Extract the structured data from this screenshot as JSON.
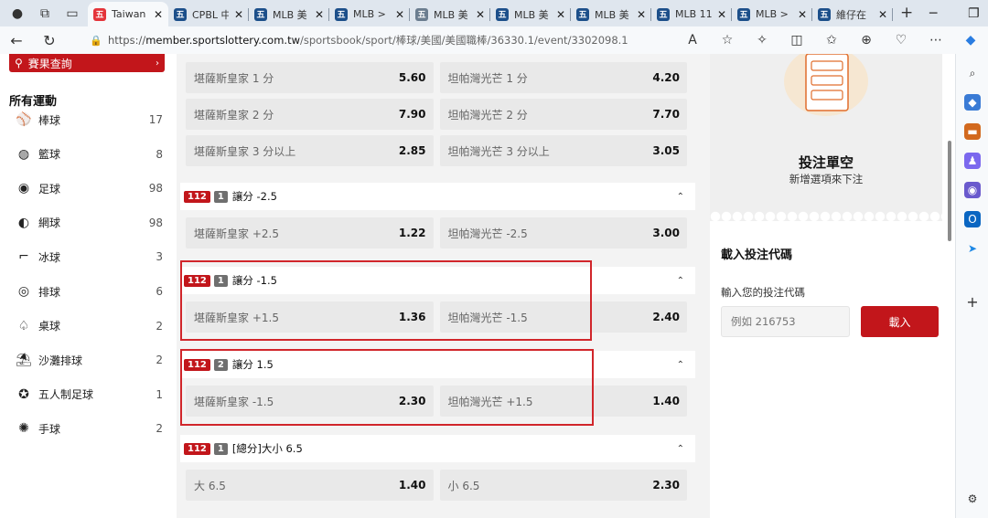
{
  "browser": {
    "tabs": [
      {
        "title": "Taiwan",
        "active": true,
        "favicon_color": "#e4343a"
      },
      {
        "title": "CPBL 中",
        "active": false,
        "favicon_color": "#1c4f8a"
      },
      {
        "title": "MLB 美",
        "active": false,
        "favicon_color": "#1c4f8a"
      },
      {
        "title": "MLB >",
        "active": false,
        "favicon_color": "#1c4f8a"
      },
      {
        "title": "MLB 美",
        "active": false,
        "favicon_color": "#6b7d8f"
      },
      {
        "title": "MLB 美",
        "active": false,
        "favicon_color": "#1c4f8a"
      },
      {
        "title": "MLB 美",
        "active": false,
        "favicon_color": "#1c4f8a"
      },
      {
        "title": "MLB 11",
        "active": false,
        "favicon_color": "#1c4f8a"
      },
      {
        "title": "MLB >",
        "active": false,
        "favicon_color": "#1c4f8a"
      },
      {
        "title": "維仔在",
        "active": false,
        "favicon_color": "#1c4f8a"
      }
    ],
    "tab_favicon_text": "五",
    "new_tab": "+",
    "url_prefix": "https://",
    "url_host": "member.sportslottery.com.tw",
    "url_path": "/sportsbook/sport/棒球/美國/美國職棒/36330.1/event/3302098.1"
  },
  "sidebar": {
    "search_results": "賽果查詢",
    "all_sports": "所有運動",
    "sports": [
      {
        "name": "棒球",
        "count": "17",
        "icon": "baseball-icon"
      },
      {
        "name": "籃球",
        "count": "8",
        "icon": "basketball-icon"
      },
      {
        "name": "足球",
        "count": "98",
        "icon": "soccer-icon"
      },
      {
        "name": "網球",
        "count": "98",
        "icon": "tennis-icon"
      },
      {
        "name": "冰球",
        "count": "3",
        "icon": "ice-hockey-icon"
      },
      {
        "name": "排球",
        "count": "6",
        "icon": "volleyball-icon"
      },
      {
        "name": "桌球",
        "count": "2",
        "icon": "table-tennis-icon"
      },
      {
        "name": "沙灘排球",
        "count": "2",
        "icon": "beach-volleyball-icon"
      },
      {
        "name": "五人制足球",
        "count": "1",
        "icon": "futsal-icon"
      },
      {
        "name": "手球",
        "count": "2",
        "icon": "handball-icon"
      }
    ]
  },
  "markets": {
    "row1": {
      "home": "堪薩斯皇家 1 分",
      "home_odd": "5.60",
      "away": "坦帕灣光芒 1 分",
      "away_odd": "4.20"
    },
    "row2": {
      "home": "堪薩斯皇家 2 分",
      "home_odd": "7.90",
      "away": "坦帕灣光芒 2 分",
      "away_odd": "7.70"
    },
    "row3": {
      "home": "堪薩斯皇家 3 分以上",
      "home_odd": "2.85",
      "away": "坦帕灣光芒 3 分以上",
      "away_odd": "3.05"
    },
    "m1": {
      "code": "112",
      "num": "1",
      "title": "讓分 -2.5",
      "home": "堪薩斯皇家 +2.5",
      "home_odd": "1.22",
      "away": "坦帕灣光芒 -2.5",
      "away_odd": "3.00"
    },
    "m2": {
      "code": "112",
      "num": "1",
      "title": "讓分 -1.5",
      "home": "堪薩斯皇家 +1.5",
      "home_odd": "1.36",
      "away": "坦帕灣光芒 -1.5",
      "away_odd": "2.40"
    },
    "m3": {
      "code": "112",
      "num": "2",
      "title": "讓分 1.5",
      "home": "堪薩斯皇家 -1.5",
      "home_odd": "2.30",
      "away": "坦帕灣光芒 +1.5",
      "away_odd": "1.40"
    },
    "m4": {
      "code": "112",
      "num": "1",
      "title": "[總分]大小 6.5",
      "home": "大 6.5",
      "home_odd": "1.40",
      "away": "小 6.5",
      "away_odd": "2.30"
    }
  },
  "betslip": {
    "title": "投注單空",
    "subtitle": "新增選項來下注",
    "code_title": "載入投注代碼",
    "code_label": "輸入您的投注代碼",
    "code_placeholder": "例如 216753",
    "code_button": "載入"
  },
  "colors": {
    "brand_red": "#c2161b",
    "highlight_red": "#d1262b"
  }
}
